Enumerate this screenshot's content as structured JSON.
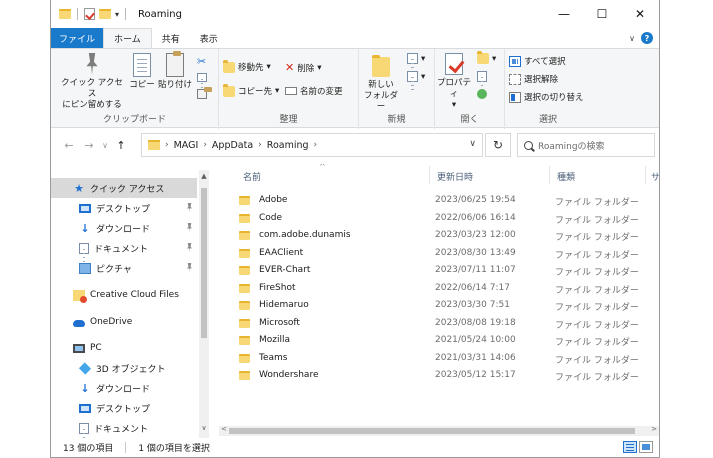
{
  "window": {
    "title": "Roaming",
    "controls": {
      "minimize": "—",
      "maximize": "☐",
      "close": "✕"
    }
  },
  "ribbon_tabs": [
    {
      "label": "ファイル"
    },
    {
      "label": "ホーム"
    },
    {
      "label": "共有"
    },
    {
      "label": "表示"
    }
  ],
  "ribbon": {
    "clipboard": {
      "pin_label": "クイック アクセス\nにピン留めする",
      "copy_label": "コピー",
      "paste_label": "貼り付け",
      "group_label": "クリップボード"
    },
    "organize": {
      "move_to": "移動先",
      "copy_to": "コピー先",
      "delete": "削除",
      "rename": "名前の変更",
      "group_label": "整理"
    },
    "new": {
      "new_folder": "新しい\nフォルダー",
      "group_label": "新規"
    },
    "open": {
      "properties": "プロパティ",
      "group_label": "開く"
    },
    "select": {
      "select_all": "すべて選択",
      "select_none": "選択解除",
      "invert_selection": "選択の切り替え",
      "group_label": "選択"
    }
  },
  "address_bar": {
    "breadcrumbs": [
      "MAGI",
      "AppData",
      "Roaming"
    ],
    "search_placeholder": "Roamingの検索"
  },
  "nav_pane": {
    "quick_access": "クイック アクセス",
    "quick_items": [
      "デスクトップ",
      "ダウンロード",
      "ドキュメント",
      "ピクチャ"
    ],
    "creative_cloud": "Creative Cloud Files",
    "onedrive": "OneDrive",
    "pc": "PC",
    "pc_items": [
      "3D オブジェクト",
      "ダウンロード",
      "デスクトップ",
      "ドキュメント"
    ]
  },
  "file_list": {
    "columns": {
      "name": "名前",
      "date": "更新日時",
      "type": "種類",
      "size": "サ"
    },
    "rows": [
      {
        "name": "Adobe",
        "date": "2023/06/25 19:54",
        "type": "ファイル フォルダー"
      },
      {
        "name": "Code",
        "date": "2022/06/06 16:14",
        "type": "ファイル フォルダー"
      },
      {
        "name": "com.adobe.dunamis",
        "date": "2023/03/23 12:00",
        "type": "ファイル フォルダー"
      },
      {
        "name": "EAAClient",
        "date": "2023/08/30 13:49",
        "type": "ファイル フォルダー"
      },
      {
        "name": "EVER-Chart",
        "date": "2023/07/11 11:07",
        "type": "ファイル フォルダー"
      },
      {
        "name": "FireShot",
        "date": "2022/06/14 7:17",
        "type": "ファイル フォルダー"
      },
      {
        "name": "Hidemaruo",
        "date": "2023/03/30 7:51",
        "type": "ファイル フォルダー"
      },
      {
        "name": "Microsoft",
        "date": "2023/08/08 19:18",
        "type": "ファイル フォルダー"
      },
      {
        "name": "Mozilla",
        "date": "2021/05/24 10:00",
        "type": "ファイル フォルダー"
      },
      {
        "name": "Teams",
        "date": "2021/03/31 14:06",
        "type": "ファイル フォルダー"
      },
      {
        "name": "Wondershare",
        "date": "2023/05/12 15:17",
        "type": "ファイル フォルダー"
      }
    ]
  },
  "status_bar": {
    "item_count": "13 個の項目",
    "selected": "1 個の項目を選択"
  },
  "colors": {
    "accent": "#1979ca",
    "folder": "#f8d775",
    "selection": "#d9d9d9"
  }
}
